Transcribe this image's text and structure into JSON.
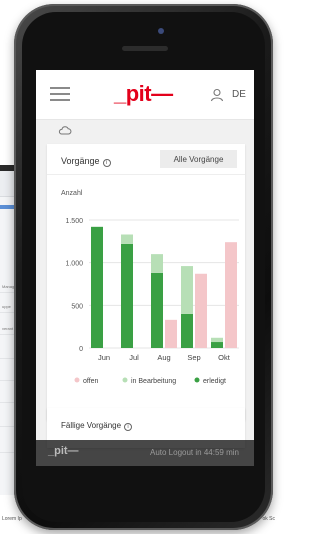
{
  "background": {
    "rows": [
      "Manag",
      "uppe",
      "verant",
      "",
      "",
      "",
      "",
      ""
    ],
    "footer_left": "Lorem Ip",
    "footer_right": "ok Sc"
  },
  "header": {
    "logo": "_pit—",
    "language": "DE",
    "menu_icon": "hamburger-icon",
    "user_icon": "user-icon"
  },
  "cloud_icon": "cloud-icon",
  "card": {
    "title": "Vorgänge",
    "button_label": "Alle Vorgänge",
    "axis_title": "Anzahl"
  },
  "chart_data": {
    "type": "bar",
    "categories": [
      "Jun",
      "Jul",
      "Aug",
      "Sep",
      "Okt"
    ],
    "yticks": [
      "1.500",
      "1.000",
      "500",
      "0"
    ],
    "ylim": [
      0,
      1500
    ],
    "series": [
      {
        "name": "offen",
        "color": "#f4c6c9",
        "values": [
          0,
          0,
          330,
          870,
          1240
        ]
      },
      {
        "name": "in Bearbeitung",
        "color": "#b7dfb6",
        "values": [
          0,
          110,
          220,
          560,
          50
        ]
      },
      {
        "name": "erledigt",
        "color": "#3aa044",
        "values": [
          1420,
          1220,
          880,
          400,
          70
        ]
      }
    ],
    "grid": true,
    "legend_position": "bottom"
  },
  "card2": {
    "title": "Fällige Vorgänge"
  },
  "footer": {
    "logo": "_pit—",
    "auto_logout": "Auto Logout in 44:59 min"
  }
}
